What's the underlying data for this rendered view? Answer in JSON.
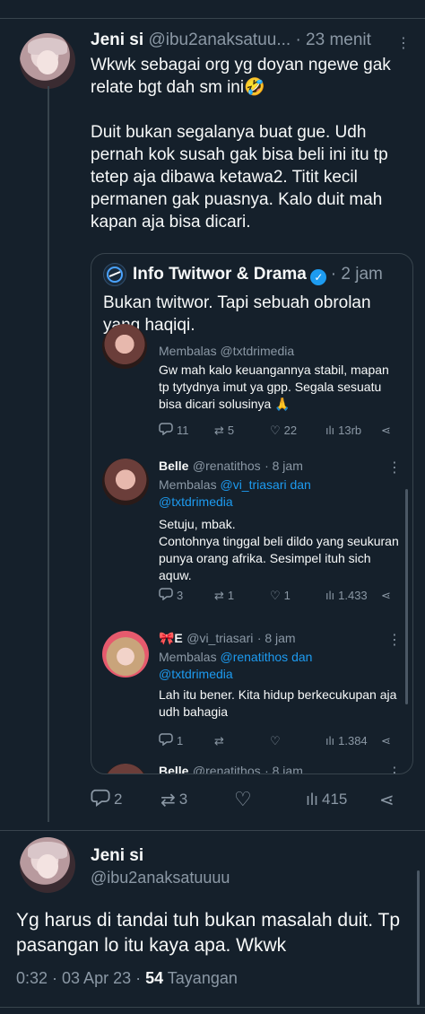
{
  "main_tweet": {
    "name": "Jeni si",
    "handle": "@ibu2anaksatuu...",
    "time": "· 23 menit",
    "text": "Wkwk sebagai org yg doyan ngewe gak relate bgt dah sm ini🤣\n\nDuit bukan segalanya buat gue. Udh pernah kok susah gak bisa beli  ini itu tp tetep aja dibawa ketawa2. Titit kecil permanen gak puasnya. Kalo duit mah kapan aja bisa dicari.",
    "actions": {
      "replies": "2",
      "retweets": "3",
      "likes": "",
      "views": "415"
    }
  },
  "quote": {
    "name": "Info Twitwor & Drama",
    "time": "· 2 jam",
    "text": "Bukan twitwor. Tapi sebuah obrolan yang haqiqi.",
    "replies": [
      {
        "reply_to": "Membalas @txtdrimedia",
        "text": "Gw mah kalo keuangannya stabil, mapan tp tytydnya imut ya gpp. Segala sesuatu bisa dicari solusinya 🙏",
        "actions": {
          "replies": "11",
          "retweets": "5",
          "likes": "22",
          "views": "13rb"
        }
      },
      {
        "name": "Belle",
        "handle": "@renatithos",
        "time": "· 8 jam",
        "reply_to_prefix": "Membalas",
        "reply_to_links": "@vi_triasari dan @txtdrimedia",
        "text": "Setuju, mbak.\nContohnya tinggal beli dildo yang seukuran punya orang afrika. Sesimpel ituh sich aquw.",
        "actions": {
          "replies": "3",
          "retweets": "1",
          "likes": "1",
          "views": "1.433"
        }
      },
      {
        "name": "🎀E",
        "handle": "@vi_triasari",
        "time": "· 8 jam",
        "reply_to_prefix": "Membalas",
        "reply_to_links": "@renatithos dan @txtdrimedia",
        "text": "Lah itu bener. Kita hidup berkecukupan aja udh bahagia",
        "actions": {
          "replies": "1",
          "retweets": "",
          "likes": "",
          "views": "1.384"
        }
      },
      {
        "name": "Belle",
        "handle": "@renatithos",
        "time": "· 8 jam"
      }
    ]
  },
  "reply_tweet": {
    "name": "Jeni si",
    "handle": "@ibu2anaksatuuuu",
    "text": "Yg harus di tandai tuh bukan masalah duit. Tp pasangan lo itu kaya apa. Wkwk",
    "meta_time": "0:32 · 03 Apr 23 · ",
    "views_count": "54",
    "views_label": " Tayangan"
  },
  "icons": [
    "reply-icon",
    "retweet-icon",
    "like-icon",
    "views-icon",
    "share-icon",
    "more-icon",
    "verified-icon"
  ],
  "colors": {
    "background": "#15202b",
    "accent": "#1d9bf0",
    "muted": "#8b98a5",
    "divider": "#38444d"
  }
}
